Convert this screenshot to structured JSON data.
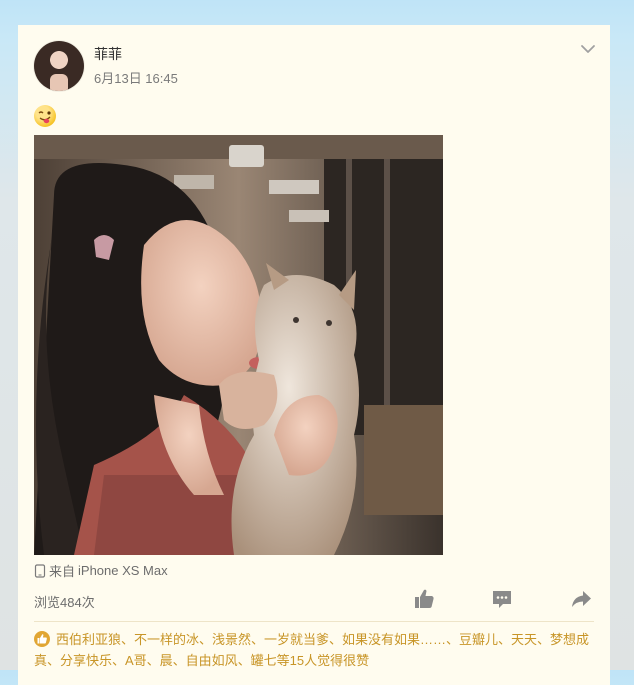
{
  "post": {
    "author": "菲菲",
    "time": "6月13日 16:45",
    "source_prefix": "来自",
    "source_device": "iPhone XS Max",
    "views": "浏览484次",
    "likes_text": "西伯利亚狼、不一样的冰、浅景然、一岁就当爹、如果没有如果……、豆瓣儿、天天、梦想成真、分享快乐、A哥、晨、自由如风、罐七等15人觉得很赞"
  },
  "icons": {
    "menu": "chevron-down-icon",
    "emoji": "tongue-wink-emoji-icon",
    "phone": "phone-icon",
    "like": "thumbs-up-icon",
    "comment": "comment-icon",
    "share": "share-arrow-icon",
    "likes_badge": "like-badge-icon"
  },
  "colors": {
    "card_bg": "#fffcef",
    "accent": "#c89527",
    "icon_gray": "#8a8a8a"
  }
}
